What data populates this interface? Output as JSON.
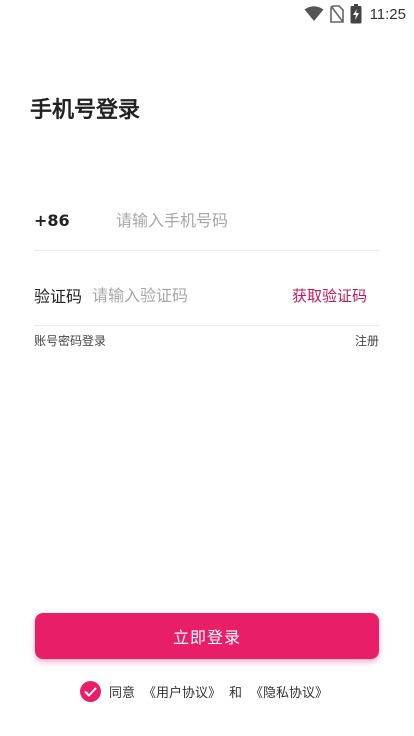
{
  "status_bar": {
    "time": "11:25",
    "icons": [
      "wifi-icon",
      "no-sim-icon",
      "battery-charging-icon"
    ]
  },
  "title": "手机号登录",
  "phone_row": {
    "prefix": "+86",
    "placeholder": "请输入手机号码"
  },
  "code_row": {
    "label": "验证码",
    "placeholder": "请输入验证码",
    "get_code": "获取验证码"
  },
  "links": {
    "password_login": "账号密码登录",
    "register": "注册"
  },
  "login_button": "立即登录",
  "agreement": {
    "agree": "同意",
    "user_agreement": "《用户协议》",
    "and": "和",
    "privacy_agreement": "《隐私协议》",
    "checked": true
  },
  "colors": {
    "accent": "#e91e68",
    "link_accent": "#c2185b"
  }
}
